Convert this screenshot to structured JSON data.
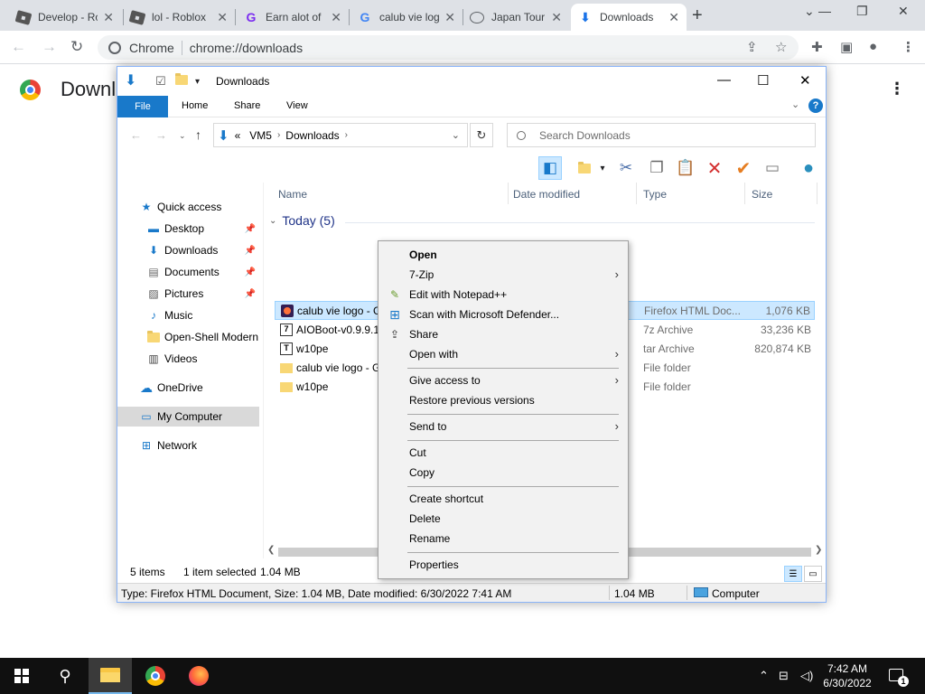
{
  "chrome": {
    "tabs": [
      {
        "title": "Develop - Roblox",
        "icon": "roblox-icon"
      },
      {
        "title": "lol - Roblox",
        "icon": "roblox-icon"
      },
      {
        "title": "Earn alot of",
        "icon": "g-icon"
      },
      {
        "title": "calub vie logo",
        "icon": "google-icon"
      },
      {
        "title": "Japan Tour",
        "icon": "globe-icon"
      },
      {
        "title": "Downloads",
        "icon": "download-icon",
        "active": true
      }
    ],
    "omnibox_label": "Chrome",
    "url": "chrome://downloads",
    "page_title": "Downl"
  },
  "explorer": {
    "title": "Downloads",
    "ribbon": {
      "file": "File",
      "home": "Home",
      "share": "Share",
      "view": "View",
      "help": "?"
    },
    "address": {
      "root": "«",
      "seg1": "VM5",
      "seg2": "Downloads"
    },
    "search_placeholder": "Search Downloads",
    "nav": [
      {
        "label": "Quick access",
        "icon": "star-icon"
      },
      {
        "label": "Desktop",
        "icon": "desktop-icon",
        "pinned": true
      },
      {
        "label": "Downloads",
        "icon": "download-icon",
        "pinned": true
      },
      {
        "label": "Documents",
        "icon": "documents-icon",
        "pinned": true
      },
      {
        "label": "Pictures",
        "icon": "pictures-icon",
        "pinned": true
      },
      {
        "label": "Music",
        "icon": "music-icon"
      },
      {
        "label": "Open-Shell Modern",
        "icon": "folder-icon"
      },
      {
        "label": "Videos",
        "icon": "videos-icon"
      },
      {
        "label": "OneDrive",
        "icon": "cloud-icon"
      },
      {
        "label": "My Computer",
        "icon": "computer-icon",
        "selected": true
      },
      {
        "label": "Network",
        "icon": "network-icon"
      }
    ],
    "columns": {
      "name": "Name",
      "date": "Date modified",
      "type": "Type",
      "size": "Size"
    },
    "group": "Today (5)",
    "files": [
      {
        "name": "calub vie logo - G",
        "type": "Firefox HTML Doc...",
        "size": "1,076 KB",
        "icon": "firefox-html-icon",
        "selected": true
      },
      {
        "name": "AIOBoot-v0.9.9.1",
        "type": "7z Archive",
        "size": "33,236 KB",
        "icon": "7zip-icon"
      },
      {
        "name": "w10pe",
        "type": "tar Archive",
        "size": "820,874 KB",
        "icon": "tar-icon"
      },
      {
        "name": "calub vie logo - G",
        "type": "File folder",
        "size": "",
        "icon": "folder-icon"
      },
      {
        "name": "w10pe",
        "type": "File folder",
        "size": "",
        "icon": "folder-icon"
      }
    ],
    "status": {
      "items": "5 items",
      "selected": "1 item selected",
      "size": "1.04 MB"
    },
    "details": {
      "info": "Type: Firefox HTML Document, Size: 1.04 MB, Date modified: 6/30/2022 7:41 AM",
      "size": "1.04 MB",
      "location": "Computer"
    }
  },
  "context_menu": [
    {
      "label": "Open",
      "bold": true
    },
    {
      "label": "7-Zip",
      "submenu": true
    },
    {
      "label": "Edit with Notepad++",
      "icon": "notepad-icon"
    },
    {
      "label": "Scan with Microsoft Defender...",
      "icon": "defender-icon"
    },
    {
      "label": "Share",
      "icon": "share-icon"
    },
    {
      "label": "Open with",
      "submenu": true
    },
    {
      "label": "Give access to",
      "submenu": true
    },
    {
      "label": "Restore previous versions"
    },
    {
      "label": "Send to",
      "submenu": true
    },
    {
      "label": "Cut"
    },
    {
      "label": "Copy"
    },
    {
      "label": "Create shortcut"
    },
    {
      "label": "Delete"
    },
    {
      "label": "Rename"
    },
    {
      "label": "Properties"
    }
  ],
  "taskbar": {
    "time": "7:42 AM",
    "date": "6/30/2022",
    "notifications": "1"
  }
}
